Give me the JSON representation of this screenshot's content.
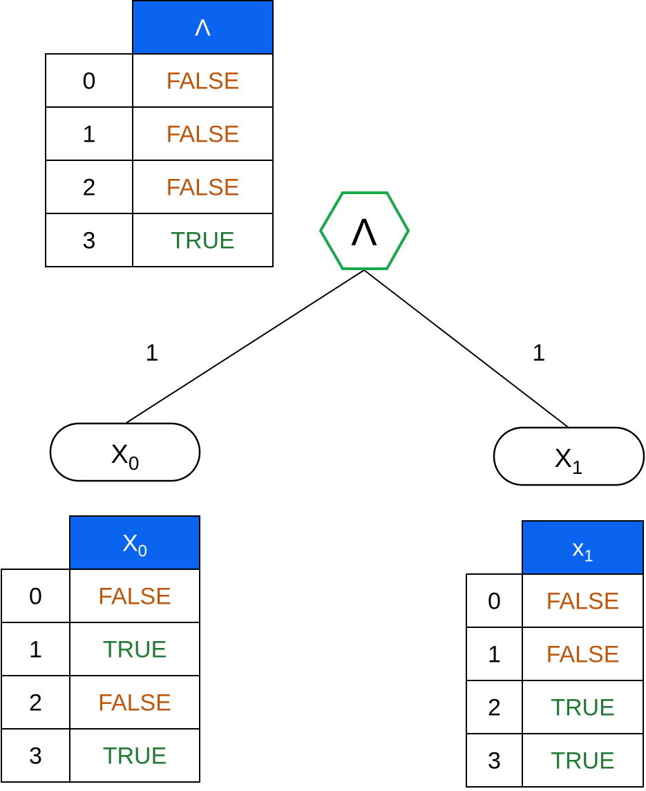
{
  "colors": {
    "header_bg": "#0a64f0",
    "false_text": "#c0560c",
    "true_text": "#1f7a34",
    "root_border": "#19a84a"
  },
  "root": {
    "label": "Λ",
    "shape": "hexagon"
  },
  "edges": [
    {
      "from": "root",
      "to": "leaf_x0",
      "weight": "1"
    },
    {
      "from": "root",
      "to": "leaf_x1",
      "weight": "1"
    }
  ],
  "leaves": {
    "x0": {
      "base": "X",
      "sub": "0"
    },
    "x1": {
      "base": "X",
      "sub": "1"
    }
  },
  "tables": {
    "root": {
      "header": {
        "base": "Λ",
        "sub": ""
      },
      "rows": [
        {
          "index": "0",
          "value": "FALSE"
        },
        {
          "index": "1",
          "value": "FALSE"
        },
        {
          "index": "2",
          "value": "FALSE"
        },
        {
          "index": "3",
          "value": "TRUE"
        }
      ]
    },
    "x0": {
      "header": {
        "base": "X",
        "sub": "0"
      },
      "rows": [
        {
          "index": "0",
          "value": "FALSE"
        },
        {
          "index": "1",
          "value": "TRUE"
        },
        {
          "index": "2",
          "value": "FALSE"
        },
        {
          "index": "3",
          "value": "TRUE"
        }
      ]
    },
    "x1": {
      "header": {
        "base": "x",
        "sub": "1"
      },
      "rows": [
        {
          "index": "0",
          "value": "FALSE"
        },
        {
          "index": "1",
          "value": "FALSE"
        },
        {
          "index": "2",
          "value": "TRUE"
        },
        {
          "index": "3",
          "value": "TRUE"
        }
      ]
    }
  }
}
